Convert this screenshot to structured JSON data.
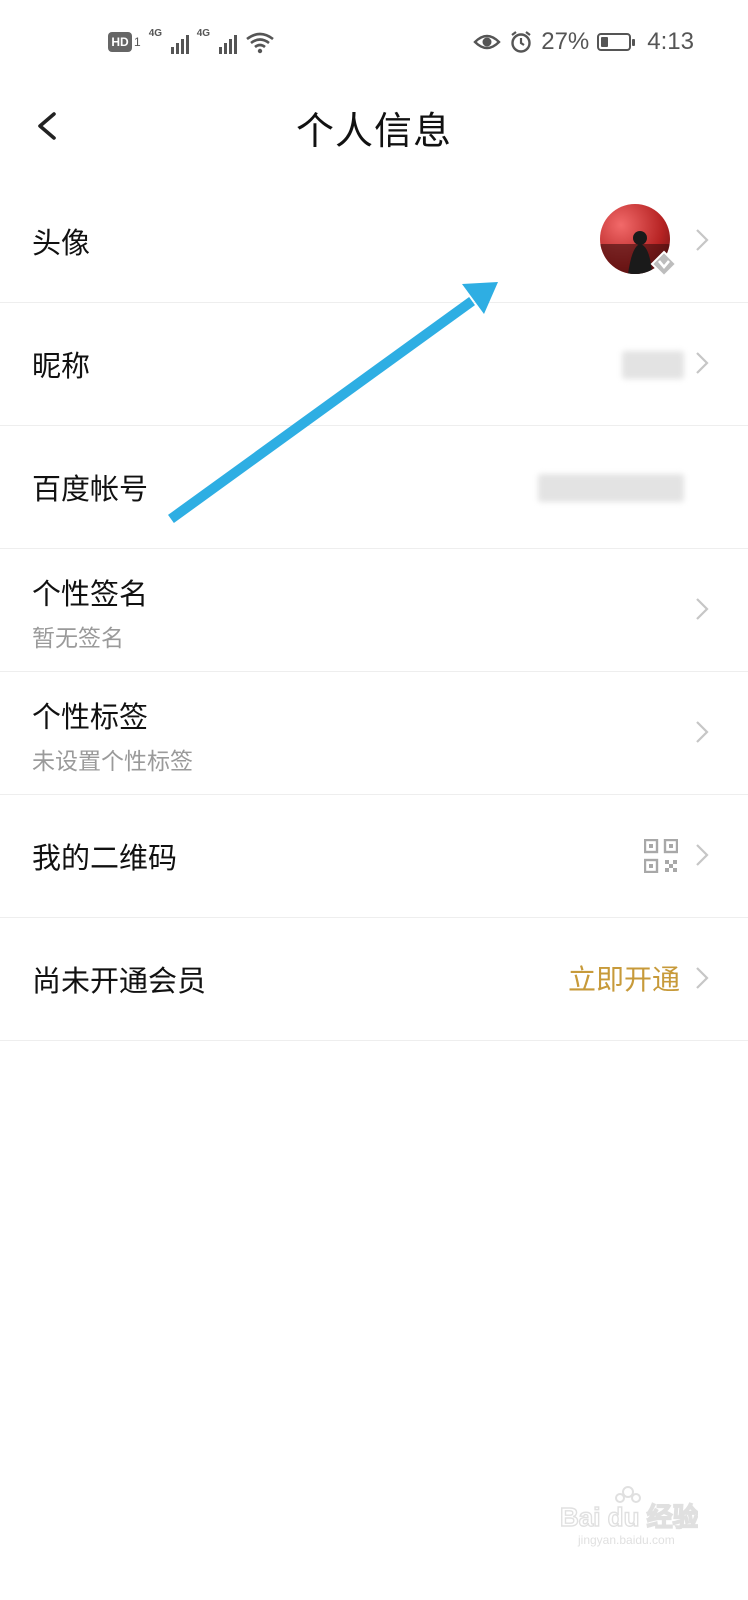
{
  "status_bar": {
    "hd_label": "HD",
    "sim_number": "1",
    "network_labels": [
      "4G",
      "4G"
    ],
    "battery_percent_text": "27%",
    "battery_level": 0.27,
    "time": "4:13"
  },
  "header": {
    "title": "个人信息",
    "back_icon": "chevron-left-icon"
  },
  "rows": [
    {
      "label": "头像"
    },
    {
      "label": "昵称"
    },
    {
      "label": "百度帐号"
    },
    {
      "label": "个性签名",
      "sub": "暂无签名"
    },
    {
      "label": "个性标签",
      "sub": "未设置个性标签"
    },
    {
      "label": "我的二维码"
    },
    {
      "label": "尚未开通会员",
      "action": "立即开通"
    }
  ],
  "colors": {
    "accent_gold": "#c79a3a",
    "arrow_blue": "#2eaee3",
    "subtext_gray": "#9a9a9a"
  },
  "watermark": {
    "text": "Bai du 经验",
    "url": "jingyan.baidu.com"
  }
}
